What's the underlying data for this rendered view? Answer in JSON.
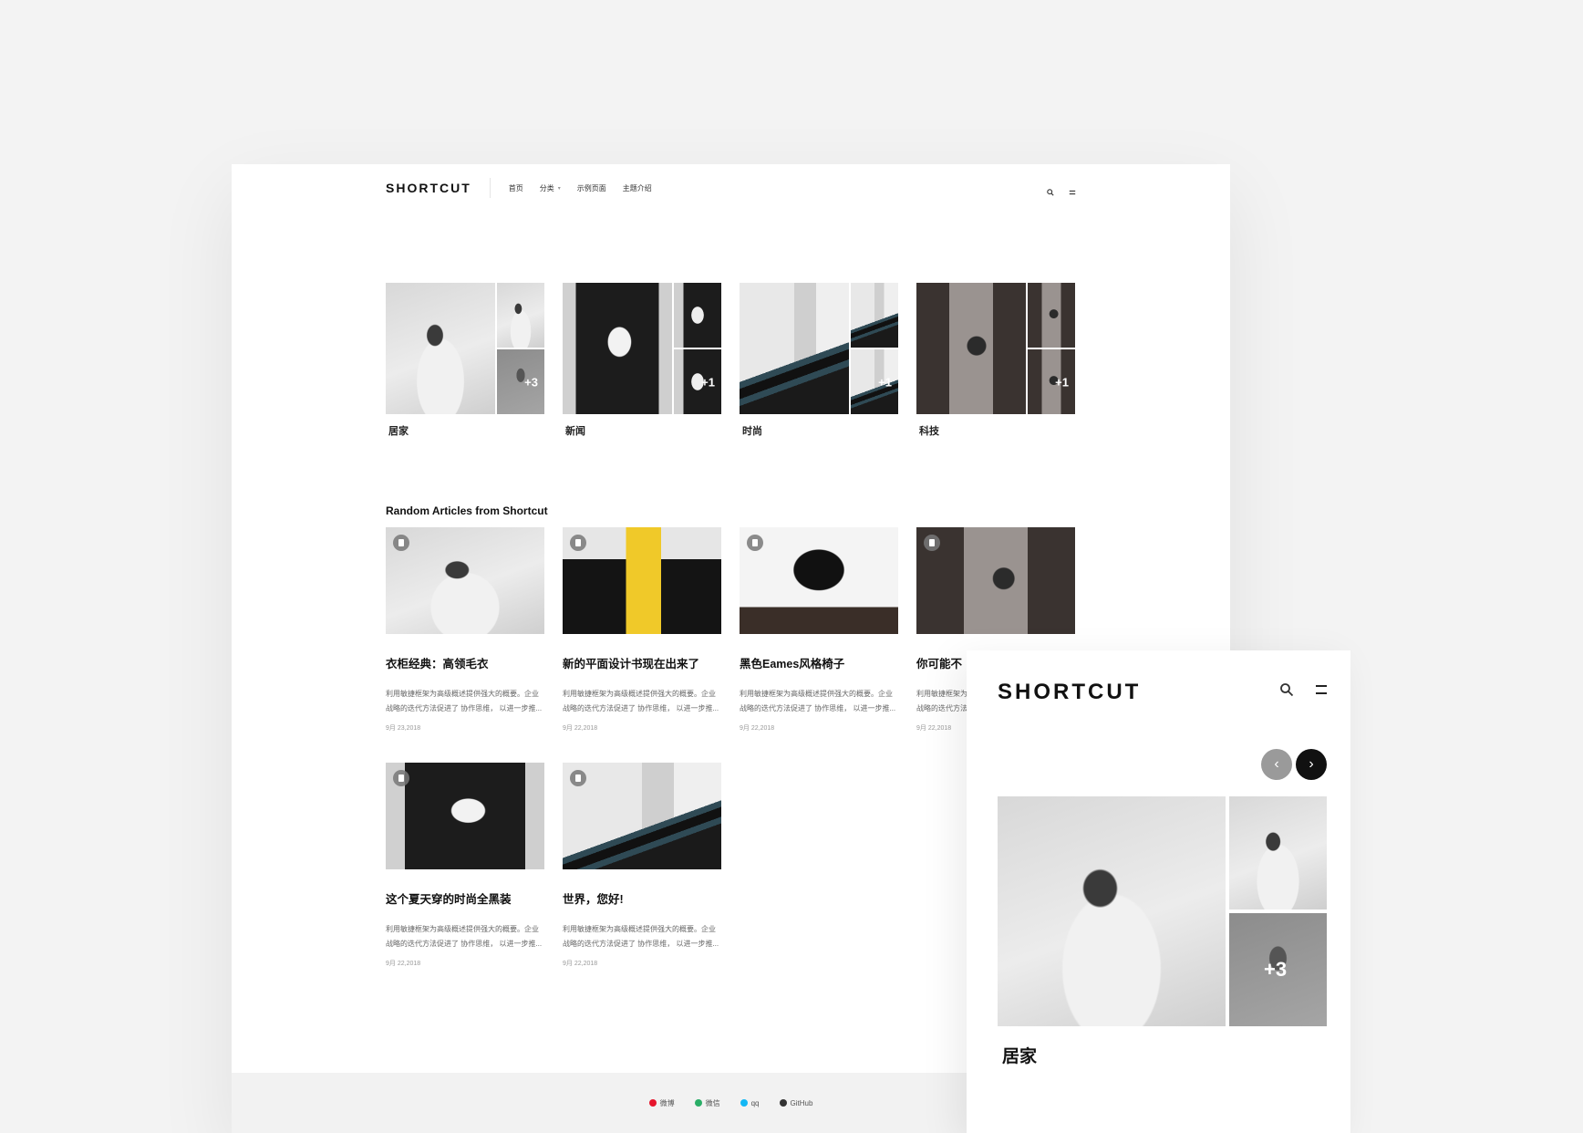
{
  "desktop": {
    "header": {
      "logo": "SHORTCUT",
      "nav": [
        {
          "label": "首页"
        },
        {
          "label": "分类"
        },
        {
          "label": "示例页面"
        },
        {
          "label": "主题介绍"
        }
      ],
      "search_icon": "search-icon",
      "menu_icon": "menu-icon"
    },
    "categories": [
      {
        "name": "居家",
        "more": "+3"
      },
      {
        "name": "新闻",
        "more": "+1"
      },
      {
        "name": "时尚",
        "more": "+1"
      },
      {
        "name": "科技",
        "more": "+1"
      }
    ],
    "section_title": "Random Articles from Shortcut",
    "articles": [
      {
        "title": "衣柜经典：高领毛衣",
        "excerpt": "利用敏捷框架为高级概述提供强大的概要。企业战略的迭代方法促进了 协作思维， 以进一步推...",
        "date": "9月 23,2018"
      },
      {
        "title": "新的平面设计书现在出来了",
        "excerpt": "利用敏捷框架为高级概述提供强大的概要。企业战略的迭代方法促进了 协作思维， 以进一步推...",
        "date": "9月 22,2018"
      },
      {
        "title": "黑色Eames风格椅子",
        "excerpt": "利用敏捷框架为高级概述提供强大的概要。企业战略的迭代方法促进了 协作思维， 以进一步推...",
        "date": "9月 22,2018"
      },
      {
        "title": "你可能不",
        "excerpt": "利用敏捷框架为高级概述提供强大的概要。企业战略的迭代方法促进了 协作思维， 以进一步推...",
        "date": "9月 22,2018"
      },
      {
        "title": "这个夏天穿的时尚全黑装",
        "excerpt": "利用敏捷框架为高级概述提供强大的概要。企业战略的迭代方法促进了 协作思维， 以进一步推...",
        "date": "9月 22,2018"
      },
      {
        "title": "世界，您好!",
        "excerpt": "利用敏捷框架为高级概述提供强大的概要。企业战略的迭代方法促进了 协作思维， 以进一步推...",
        "date": "9月 22,2018"
      }
    ],
    "footer": [
      {
        "label": "微博",
        "color": "#e6162d"
      },
      {
        "label": "微信",
        "color": "#2aae67"
      },
      {
        "label": "qq",
        "color": "#12b7f5"
      },
      {
        "label": "GitHub",
        "color": "#333333"
      }
    ]
  },
  "mobile": {
    "logo": "SHORTCUT",
    "category_name": "居家",
    "more": "+3",
    "prev_icon": "chevron-left-icon",
    "next_icon": "chevron-right-icon"
  }
}
